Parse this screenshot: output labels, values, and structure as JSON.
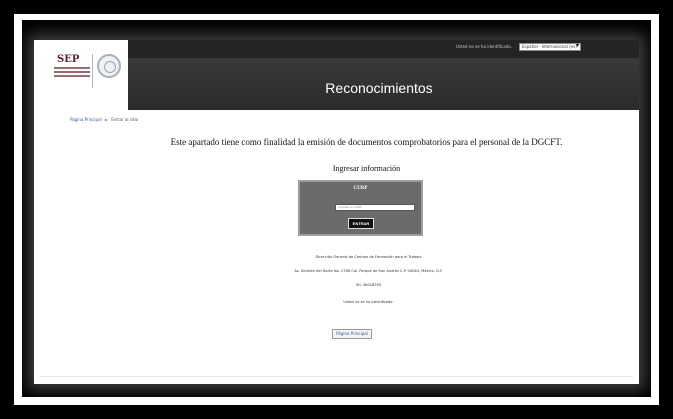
{
  "header": {
    "title": "Reconocimientos",
    "logo_text": "SEP",
    "identity_text": "Usted no se ha identificado.",
    "language_select": "Español - Internacional (es)"
  },
  "breadcrumb": {
    "home": "Página Principal",
    "separator": "►",
    "current": "Entrar al sitio"
  },
  "intro_text": "Este apartado tiene como finalidad la emisión de documentos comprobatorios para el personal de la DGCFT.",
  "form": {
    "heading": "Ingresar información",
    "field_label": "CURP",
    "input_value": "",
    "input_placeholder": "Ingrese la CURP",
    "submit_label": "ENTRAR"
  },
  "footer": {
    "line1": "Dirección General de Centros de Formación para el Trabajo",
    "line2": "Av. División del Norte No. 2786 Col. Parque de San Andrés C.P. 04040, México, D.F.",
    "line3": "Tel. 36018550",
    "login_status": "Usted no se ha identificado.",
    "home_button": "Página Principal"
  },
  "colors": {
    "header_bg": "#2a2b2d",
    "form_bg": "#6a6b6d",
    "link": "#2d5a9a"
  }
}
